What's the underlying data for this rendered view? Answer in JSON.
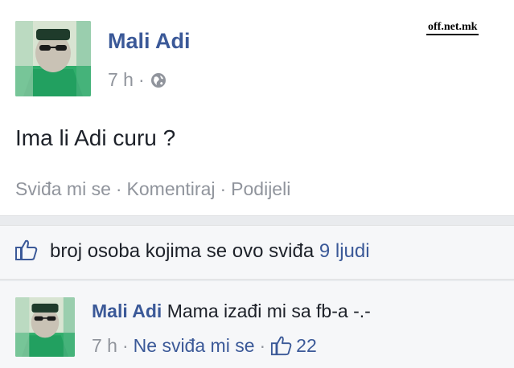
{
  "post": {
    "author": "Mali Adi",
    "time": "7 h",
    "dot": "·",
    "privacy_icon": "globe-icon",
    "text": "Ima li Adi curu ?",
    "actions": {
      "like": "Sviđa mi se",
      "comment": "Komentiraj",
      "share": "Podijeli",
      "separator": "·"
    }
  },
  "watermark": "off.net.mk",
  "likes": {
    "icon": "thumbs-up-icon",
    "text": "broj osoba kojima se ovo sviđa",
    "count": "9 ljudi"
  },
  "comment": {
    "author": "Mali Adi",
    "text": "Mama izađi mi sa fb-a -.-",
    "time": "7 h",
    "unlike": "Ne sviđa mi se",
    "separator": "·",
    "like_icon": "thumbs-up-icon",
    "like_count": "22"
  },
  "colors": {
    "link_blue": "#3b5998",
    "meta_gray": "#90949c",
    "text_dark": "#1d2129",
    "background": "#e9ebee"
  }
}
